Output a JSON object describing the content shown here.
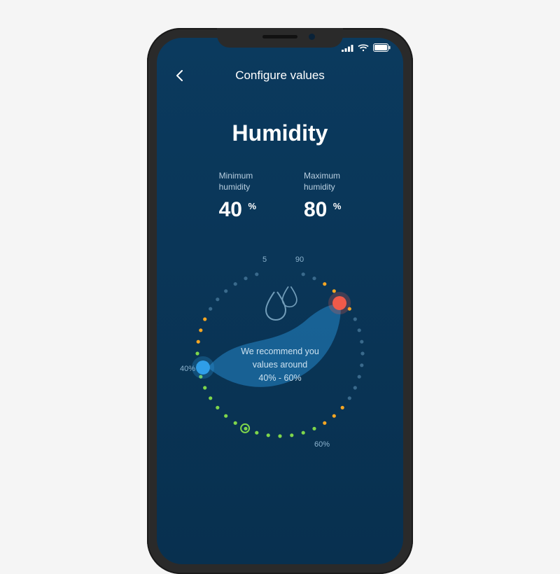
{
  "header": {
    "title": "Configure values"
  },
  "page": {
    "title": "Humidity"
  },
  "values": {
    "min": {
      "label": "Minimum\nhumidity",
      "number": "40",
      "unit": "%"
    },
    "max": {
      "label": "Maximum\nhumidity",
      "number": "80",
      "unit": "%"
    }
  },
  "dial": {
    "tick_top_left": "5",
    "tick_top_right": "90",
    "tick_left": "40%",
    "tick_bottom": "60%",
    "recommend_line1": "We recommend you",
    "recommend_line2": "values around",
    "recommend_line3": "40% - 60%",
    "min_value": 40,
    "max_value": 80,
    "recommended_range": [
      40,
      60
    ]
  },
  "colors": {
    "background": "#0b3a5e",
    "handle_min": "#2f9ee8",
    "handle_max": "#f05a4a",
    "dot_green": "#7fd64b",
    "dot_orange": "#f5a623",
    "dot_inactive": "#3a6a8c",
    "fill": "#1b6aa0"
  }
}
